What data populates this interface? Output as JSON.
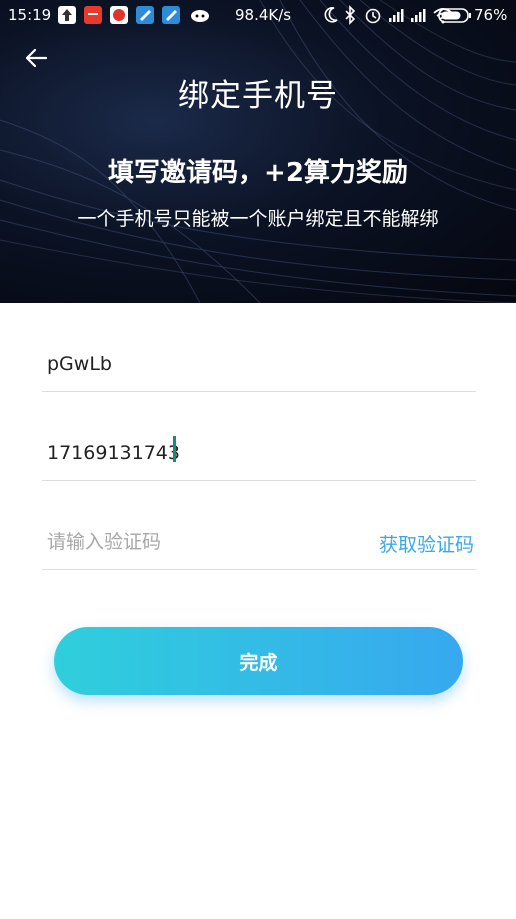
{
  "status_bar": {
    "time": "15:19",
    "network_speed": "98.4K/s",
    "battery_percent": "76%",
    "icons": [
      "upload-icon",
      "taobao-app-icon",
      "weibo-app-icon",
      "note-app-icon",
      "note-app-icon-2",
      "game-app-icon",
      "moon-icon",
      "bluetooth-icon",
      "alarm-icon",
      "signal-icon",
      "signal-icon-2",
      "wifi-icon",
      "battery-icon"
    ]
  },
  "header": {
    "back_icon": "arrow-left-icon",
    "title": "绑定手机号",
    "promo_title": "填写邀请码，+2算力奖励",
    "promo_subtitle": "一个手机号只能被一个账户绑定且不能解绑"
  },
  "form": {
    "invite_code_value": "pGwLb",
    "phone_value": "17169131743",
    "code_placeholder": "请输入验证码",
    "get_code_label": "获取验证码",
    "submit_label": "完成"
  },
  "colors": {
    "accent": "#3aa8e6",
    "button_gradient_start": "#2fcfdc",
    "button_gradient_end": "#37a8ef",
    "header_bg": "#0b1224"
  }
}
